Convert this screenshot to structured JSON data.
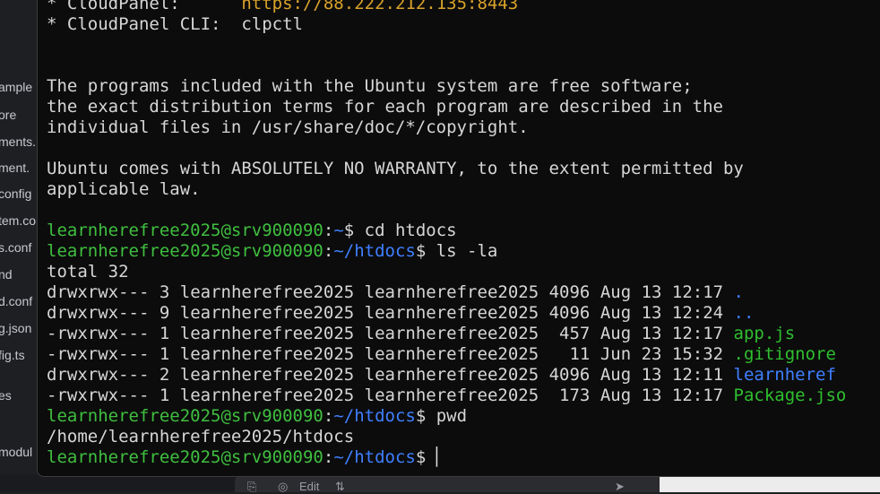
{
  "sidebar": {
    "items": [
      "ample",
      "ore",
      "ments.",
      "ment.",
      "config",
      "tem.co",
      "s.conf",
      "nd",
      "d.conf",
      "g.json",
      "fig.ts",
      "es",
      "modul"
    ]
  },
  "chat_toolbar": {
    "edit_label": "Edit",
    "icons": [
      "attach-icon",
      "edit-icon",
      "sliders-icon",
      "send-icon"
    ]
  },
  "terminal": {
    "motd": {
      "cloudpanel_label": "* CloudPanel:",
      "cloudpanel_url": "https://88.222.212.135:8443",
      "cli_label": "* CloudPanel CLI:",
      "cli_value": "clpctl",
      "license_line1": "The programs included with the Ubuntu system are free software;",
      "license_line2": "the exact distribution terms for each program are described in the",
      "license_line3": "individual files in /usr/share/doc/*/copyright.",
      "warranty_line1": "Ubuntu comes with ABSOLUTELY NO WARRANTY, to the extent permitted by",
      "warranty_line2": "applicable law."
    },
    "prompt_user": "learnherefree2025@srv900090",
    "cmd1": {
      "path": "~",
      "command": "cd htdocs"
    },
    "cmd2": {
      "path": "~/htdocs",
      "command": "ls -la"
    },
    "ls_total": "total 32",
    "ls_rows": [
      {
        "perms": "drwxrwx---",
        "links": "3",
        "owner": "learnherefree2025",
        "group": "learnherefree2025",
        "size": "4096",
        "date": "Aug 13 12:17",
        "name": "."
      },
      {
        "perms": "drwxrwx---",
        "links": "9",
        "owner": "learnherefree2025",
        "group": "learnherefree2025",
        "size": "4096",
        "date": "Aug 13 12:24",
        "name": ".."
      },
      {
        "perms": "-rwxrwx---",
        "links": "1",
        "owner": "learnherefree2025",
        "group": "learnherefree2025",
        "size": " 457",
        "date": "Aug 13 12:17",
        "name": "app.js"
      },
      {
        "perms": "-rwxrwx---",
        "links": "1",
        "owner": "learnherefree2025",
        "group": "learnherefree2025",
        "size": "  11",
        "date": "Jun 23 15:32",
        "name": ".gitignore"
      },
      {
        "perms": "drwxrwx---",
        "links": "2",
        "owner": "learnherefree2025",
        "group": "learnherefree2025",
        "size": "4096",
        "date": "Aug 13 12:11",
        "name": "learnheref"
      },
      {
        "perms": "-rwxrwx---",
        "links": "1",
        "owner": "learnherefree2025",
        "group": "learnherefree2025",
        "size": " 173",
        "date": "Aug 13 12:17",
        "name": "Package.jso"
      }
    ],
    "cmd3": {
      "path": "~/htdocs",
      "command": "pwd"
    },
    "pwd_output": "/home/learnherefree2025/htdocs",
    "cmd4": {
      "path": "~/htdocs",
      "command": ""
    },
    "colors": {
      "user": "#3fbf3f",
      "path": "#3f7fff",
      "url": "#d9a32a",
      "text": "#d6d6d6",
      "background": "#0c0c0c"
    }
  }
}
